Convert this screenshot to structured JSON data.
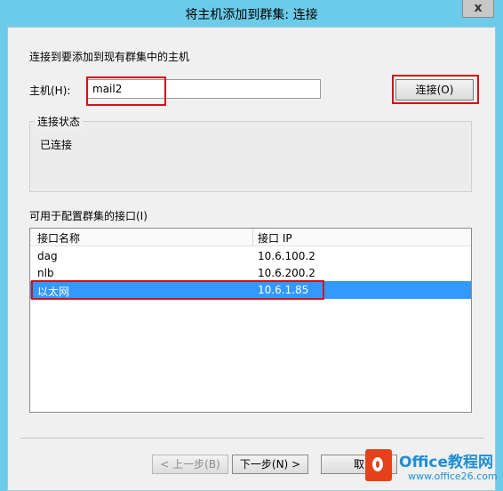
{
  "window": {
    "title": "将主机添加到群集: 连接",
    "close_glyph": "x"
  },
  "form": {
    "heading": "连接到要添加到现有群集中的主机",
    "host_label": "主机(H):",
    "host_value": "mail2",
    "connect_label": "连接(O)"
  },
  "status": {
    "legend": "连接状态",
    "value": "已连接"
  },
  "interfaces": {
    "label": "可用于配置群集的接口(I)",
    "columns": [
      "接口名称",
      "接口 IP"
    ],
    "rows": [
      {
        "name": "dag",
        "ip": "10.6.100.2"
      },
      {
        "name": "nlb",
        "ip": "10.6.200.2"
      },
      {
        "name": "以太网",
        "ip": "10.6.1.85",
        "selected": true
      }
    ]
  },
  "footer": {
    "back_label": "< 上一步(B)",
    "next_label": "下一步(N) >",
    "cancel_label": "取"
  },
  "watermark": {
    "brand": "Office教程网",
    "site": "www.office26.com"
  },
  "colors": {
    "titlebar": "#6ccbe8",
    "highlight": "#d3111b",
    "selection": "#3399ff"
  }
}
